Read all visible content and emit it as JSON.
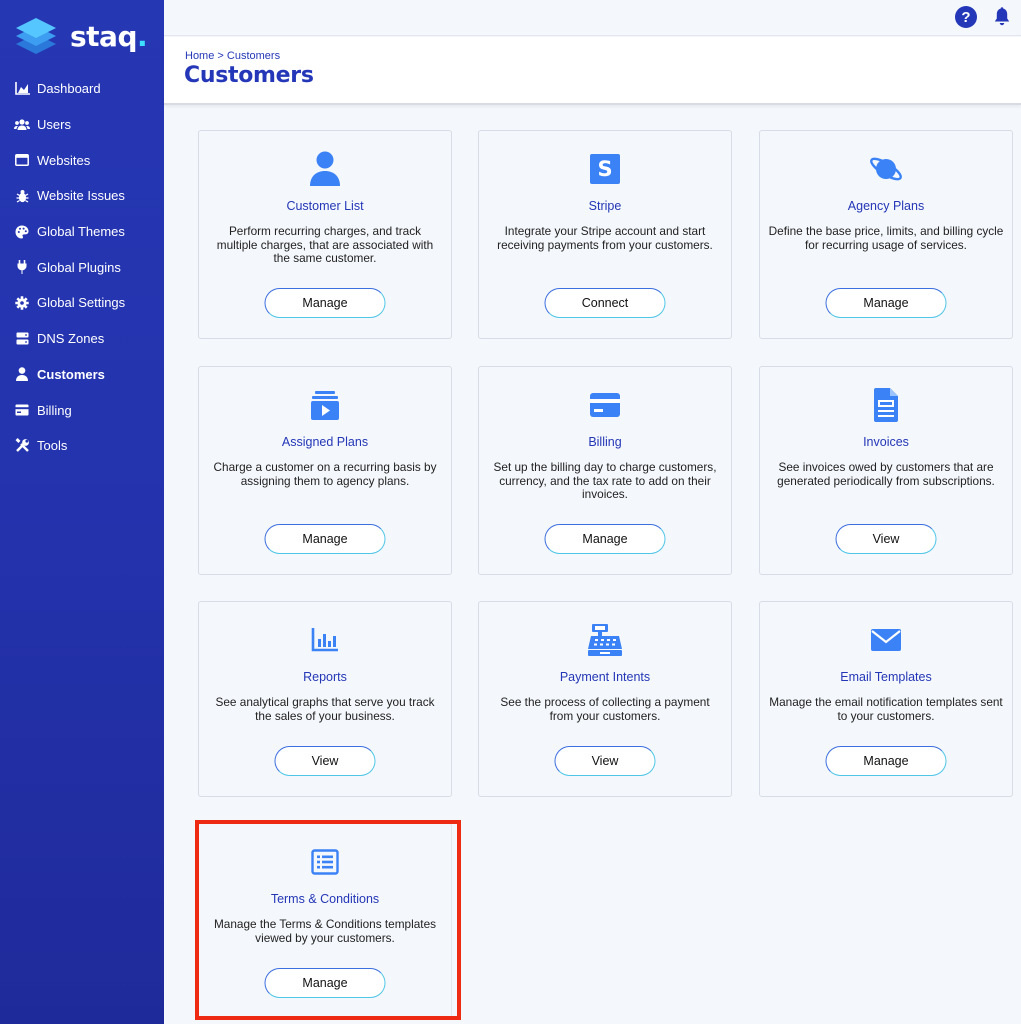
{
  "brand": {
    "name": "staq",
    "dot": "."
  },
  "sidebar": {
    "items": [
      {
        "label": "Dashboard",
        "icon": "chart-area-icon"
      },
      {
        "label": "Users",
        "icon": "users-icon"
      },
      {
        "label": "Websites",
        "icon": "window-icon"
      },
      {
        "label": "Website Issues",
        "icon": "bug-icon"
      },
      {
        "label": "Global Themes",
        "icon": "palette-icon"
      },
      {
        "label": "Global Plugins",
        "icon": "plug-icon"
      },
      {
        "label": "Global Settings",
        "icon": "gear-icon"
      },
      {
        "label": "DNS Zones",
        "icon": "server-icon"
      },
      {
        "label": "Customers",
        "icon": "user-icon",
        "active": true
      },
      {
        "label": "Billing",
        "icon": "billing-icon"
      },
      {
        "label": "Tools",
        "icon": "tools-icon"
      }
    ]
  },
  "topbar": {
    "help_label": "?"
  },
  "header": {
    "breadcrumb_home": "Home",
    "breadcrumb_sep": ">",
    "breadcrumb_current": "Customers",
    "title": "Customers"
  },
  "cards": [
    {
      "title": "Customer List",
      "desc": "Perform recurring charges, and track multiple charges, that are associated with the same customer.",
      "button": "Manage",
      "icon": "user-icon"
    },
    {
      "title": "Stripe",
      "desc": "Integrate your Stripe account and start receiving payments from your customers.",
      "button": "Connect",
      "icon": "stripe-icon",
      "icon_letter": "S"
    },
    {
      "title": "Agency Plans",
      "desc": "Define the base price, limits, and billing cycle for recurring usage of services.",
      "button": "Manage",
      "icon": "planet-icon"
    },
    {
      "title": "Assigned Plans",
      "desc": "Charge a customer on a recurring basis by assigning them to agency plans.",
      "button": "Manage",
      "icon": "media-stack-icon"
    },
    {
      "title": "Billing",
      "desc": "Set up the billing day to charge customers, currency, and the tax rate to add on their invoices.",
      "button": "Manage",
      "icon": "credit-card-icon"
    },
    {
      "title": "Invoices",
      "desc": "See invoices owed by customers that are generated periodically from subscriptions.",
      "button": "View",
      "icon": "invoice-icon"
    },
    {
      "title": "Reports",
      "desc": "See analytical graphs that serve you track the sales of your business.",
      "button": "View",
      "icon": "bar-chart-icon"
    },
    {
      "title": "Payment Intents",
      "desc": "See the process of collecting a payment from your customers.",
      "button": "View",
      "icon": "cash-register-icon"
    },
    {
      "title": "Email Templates",
      "desc": "Manage the email notification templates sent to your customers.",
      "button": "Manage",
      "icon": "envelope-icon"
    },
    {
      "title": "Terms & Conditions",
      "desc": "Manage the Terms & Conditions templates viewed by your customers.",
      "button": "Manage",
      "icon": "list-icon"
    }
  ],
  "colors": {
    "accent": "#2437b8",
    "icon_blue": "#3b82f6",
    "highlight": "#ee2a12"
  }
}
